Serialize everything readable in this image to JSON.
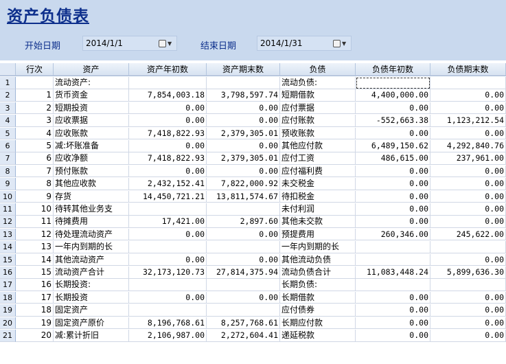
{
  "title": "资产负债表",
  "filters": {
    "start_label": "开始日期",
    "start_value": "2014/1/1",
    "end_label": "结束日期",
    "end_value": "2014/1/31"
  },
  "columns": [
    "行次",
    "资产",
    "资产年初数",
    "资产期末数",
    "负债",
    "负债年初数",
    "负债期末数"
  ],
  "rows": [
    {
      "n": "1",
      "line": "",
      "asset": "流动资产:",
      "a_begin": "",
      "a_end": "",
      "liab": "流动负债:",
      "l_begin": "",
      "l_end": ""
    },
    {
      "n": "2",
      "line": "1",
      "asset": "货币资金",
      "a_begin": "7,854,003.18",
      "a_end": "3,798,597.74",
      "liab": "短期借款",
      "l_begin": "4,400,000.00",
      "l_end": "0.00"
    },
    {
      "n": "3",
      "line": "2",
      "asset": "短期投资",
      "a_begin": "0.00",
      "a_end": "0.00",
      "liab": "应付票据",
      "l_begin": "0.00",
      "l_end": "0.00"
    },
    {
      "n": "4",
      "line": "3",
      "asset": "应收票据",
      "a_begin": "0.00",
      "a_end": "0.00",
      "liab": "应付账款",
      "l_begin": "-552,663.38",
      "l_end": "1,123,212.54"
    },
    {
      "n": "5",
      "line": "4",
      "asset": "应收账款",
      "a_begin": "7,418,822.93",
      "a_end": "2,379,305.01",
      "liab": "预收账款",
      "l_begin": "0.00",
      "l_end": "0.00"
    },
    {
      "n": "6",
      "line": "5",
      "asset": "减:坏账准备",
      "a_begin": "0.00",
      "a_end": "0.00",
      "liab": "其他应付款",
      "l_begin": "6,489,150.62",
      "l_end": "4,292,840.76"
    },
    {
      "n": "7",
      "line": "6",
      "asset": "应收净额",
      "a_begin": "7,418,822.93",
      "a_end": "2,379,305.01",
      "liab": "应付工资",
      "l_begin": "486,615.00",
      "l_end": "237,961.00"
    },
    {
      "n": "8",
      "line": "7",
      "asset": "预付账款",
      "a_begin": "0.00",
      "a_end": "0.00",
      "liab": "应付福利费",
      "l_begin": "0.00",
      "l_end": "0.00"
    },
    {
      "n": "9",
      "line": "8",
      "asset": "其他应收款",
      "a_begin": "2,432,152.41",
      "a_end": "7,822,000.92",
      "liab": "未交税金",
      "l_begin": "0.00",
      "l_end": "0.00"
    },
    {
      "n": "10",
      "line": "9",
      "asset": "存货",
      "a_begin": "14,450,721.21",
      "a_end": "13,811,574.67",
      "liab": "待扣税金",
      "l_begin": "0.00",
      "l_end": "0.00"
    },
    {
      "n": "11",
      "line": "10",
      "asset": "待转其他业务支",
      "a_begin": "",
      "a_end": "",
      "liab": "未付利润",
      "l_begin": "0.00",
      "l_end": "0.00"
    },
    {
      "n": "12",
      "line": "11",
      "asset": "待摊费用",
      "a_begin": "17,421.00",
      "a_end": "2,897.60",
      "liab": "其他未交款",
      "l_begin": "0.00",
      "l_end": "0.00"
    },
    {
      "n": "13",
      "line": "12",
      "asset": "待处理流动资产",
      "a_begin": "0.00",
      "a_end": "0.00",
      "liab": "预提费用",
      "l_begin": "260,346.00",
      "l_end": "245,622.00"
    },
    {
      "n": "14",
      "line": "13",
      "asset": "一年内到期的长",
      "a_begin": "",
      "a_end": "",
      "liab": "一年内到期的长",
      "l_begin": "",
      "l_end": ""
    },
    {
      "n": "15",
      "line": "14",
      "asset": "其他流动资产",
      "a_begin": "0.00",
      "a_end": "0.00",
      "liab": "其他流动负债",
      "l_begin": "",
      "l_end": "0.00"
    },
    {
      "n": "16",
      "line": "15",
      "asset": "流动资产合计",
      "a_begin": "32,173,120.73",
      "a_end": "27,814,375.94",
      "liab": "流动负债合计",
      "l_begin": "11,083,448.24",
      "l_end": "5,899,636.30"
    },
    {
      "n": "17",
      "line": "16",
      "asset": "长期投资:",
      "a_begin": "",
      "a_end": "",
      "liab": "长期负债:",
      "l_begin": "",
      "l_end": ""
    },
    {
      "n": "18",
      "line": "17",
      "asset": "长期投资",
      "a_begin": "0.00",
      "a_end": "0.00",
      "liab": "长期借款",
      "l_begin": "0.00",
      "l_end": "0.00"
    },
    {
      "n": "19",
      "line": "18",
      "asset": "固定资产",
      "a_begin": "",
      "a_end": "",
      "liab": "应付债券",
      "l_begin": "0.00",
      "l_end": "0.00"
    },
    {
      "n": "20",
      "line": "19",
      "asset": "固定资产原价",
      "a_begin": "8,196,768.61",
      "a_end": "8,257,768.61",
      "liab": "长期应付款",
      "l_begin": "0.00",
      "l_end": "0.00"
    },
    {
      "n": "21",
      "line": "20",
      "asset": "减:累计折旧",
      "a_begin": "2,106,987.00",
      "a_end": "2,272,604.41",
      "liab": "递延税款",
      "l_begin": "0.00",
      "l_end": "0.00"
    }
  ]
}
